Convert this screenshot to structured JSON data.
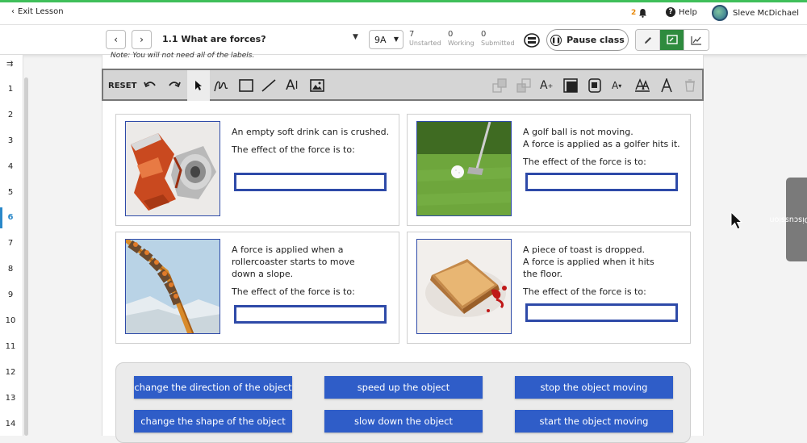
{
  "topbar": {
    "exit_label": "Exit Lesson",
    "notification_count": "2",
    "help_label": "Help",
    "user_name": "Sleve McDichael"
  },
  "lessonbar": {
    "lesson_title": "1.1 What are forces?",
    "class_value": "9A",
    "stats": [
      {
        "value": "7",
        "label": "Unstarted"
      },
      {
        "value": "0",
        "label": "Working"
      },
      {
        "value": "0",
        "label": "Submitted"
      }
    ],
    "pause_label": "Pause class"
  },
  "gutter": {
    "lines": [
      "1",
      "2",
      "3",
      "4",
      "5",
      "6",
      "7",
      "8",
      "9",
      "10",
      "11",
      "12",
      "13",
      "14"
    ],
    "active_line": "6"
  },
  "page": {
    "note": "Note: You will not need all of the labels."
  },
  "toolbar": {
    "reset_label": "RESET",
    "text_tool_label": "A",
    "font_size_label": "A",
    "text_style_label": "A"
  },
  "cards": [
    {
      "lines": [
        "An empty soft drink can is crushed."
      ],
      "prompt": "The effect of the force is to:",
      "image": "crushed-can"
    },
    {
      "lines": [
        "A golf ball is not moving.",
        "A force is applied as a golfer hits it."
      ],
      "prompt": "The effect of the force is to:",
      "image": "golf-ball"
    },
    {
      "lines": [
        "A force is applied when a rollercoaster starts to move down a slope."
      ],
      "prompt": "The effect of the force is to:",
      "image": "rollercoaster"
    },
    {
      "lines": [
        "A piece of toast is dropped.",
        "A force is applied when it hits the floor."
      ],
      "prompt": "The effect of the force is to:",
      "image": "toast"
    }
  ],
  "labels": [
    "change the direction of the object",
    "speed up the object",
    "stop the object moving",
    "change the shape of the object",
    "slow down the object",
    "start the object moving"
  ],
  "side_tab": {
    "label": "Class Discussion"
  },
  "colors": {
    "accent": "#2f5dc8",
    "slot_border": "#2e4aa8",
    "active_green": "#2e8b3e",
    "top_green": "#3fbf5a",
    "line_active": "#2a88c9"
  }
}
